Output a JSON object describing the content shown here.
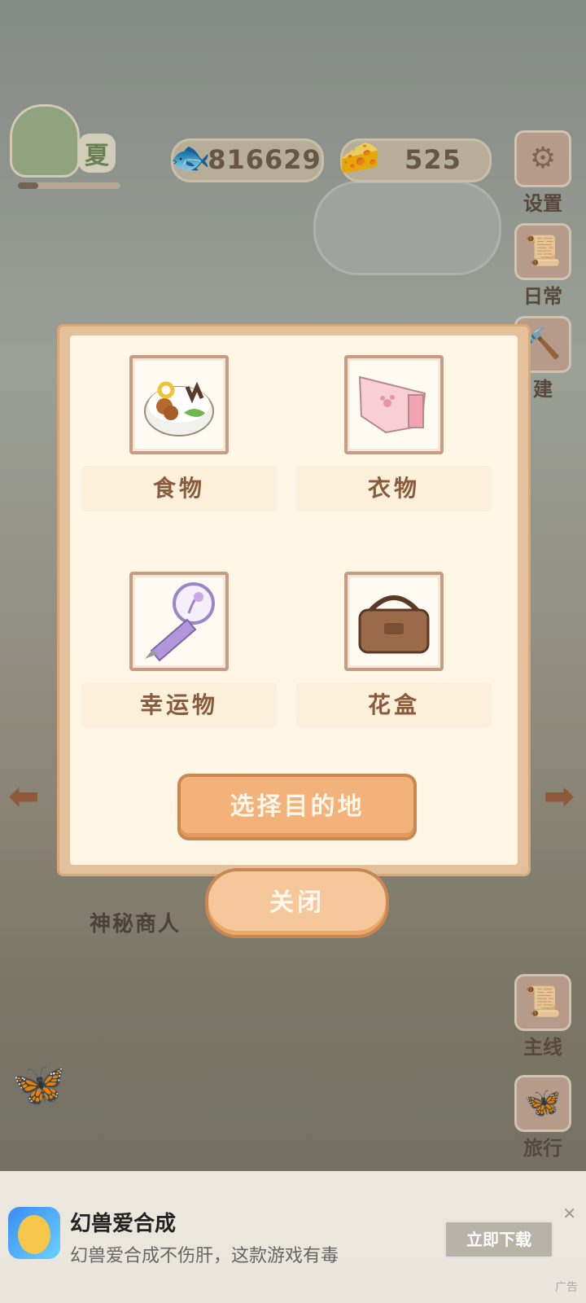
{
  "hud": {
    "season": {
      "label": "夏",
      "progress": 0.2
    },
    "fish_count": "816629",
    "cheese_count": "525"
  },
  "side_menu": {
    "settings": "设置",
    "daily": "日常",
    "build": "建",
    "main_quest": "主线",
    "travel": "旅行"
  },
  "scene": {
    "merchant_label": "神秘商人"
  },
  "modal": {
    "items": [
      {
        "label": "食物",
        "icon": "food-bowl-icon"
      },
      {
        "label": "衣物",
        "icon": "clothing-icon"
      },
      {
        "label": "幸运物",
        "icon": "lucky-charm-icon"
      },
      {
        "label": "花盒",
        "icon": "flower-box-icon"
      }
    ],
    "primary_label": "选择目的地",
    "close_label": "关闭"
  },
  "ad": {
    "app_name": "幻兽爱合成",
    "desc": "幻兽爱合成不伤肝，这款游戏有毒",
    "cta": "立即下载",
    "tag": "广告"
  }
}
